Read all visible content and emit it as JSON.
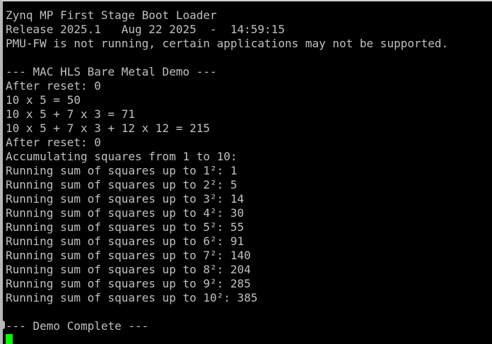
{
  "terminal": {
    "lines": [
      "Zynq MP First Stage Boot Loader",
      "Release 2025.1   Aug 22 2025  -  14:59:15",
      "PMU-FW is not running, certain applications may not be supported.",
      "",
      "--- MAC HLS Bare Metal Demo ---",
      "After reset: 0",
      "10 x 5 = 50",
      "10 x 5 + 7 x 3 = 71",
      "10 x 5 + 7 x 3 + 12 x 12 = 215",
      "After reset: 0",
      "Accumulating squares from 1 to 10:",
      "Running sum of squares up to 1²: 1",
      "Running sum of squares up to 2²: 5",
      "Running sum of squares up to 3²: 14",
      "Running sum of squares up to 4²: 30",
      "Running sum of squares up to 5²: 55",
      "Running sum of squares up to 6²: 91",
      "Running sum of squares up to 7²: 140",
      "Running sum of squares up to 8²: 204",
      "Running sum of squares up to 9²: 285",
      "Running sum of squares up to 10²: 385",
      "",
      "--- Demo Complete ---"
    ],
    "colors": {
      "background": "#000000",
      "text": "#c0c0c0",
      "cursor": "#00ff00"
    }
  }
}
